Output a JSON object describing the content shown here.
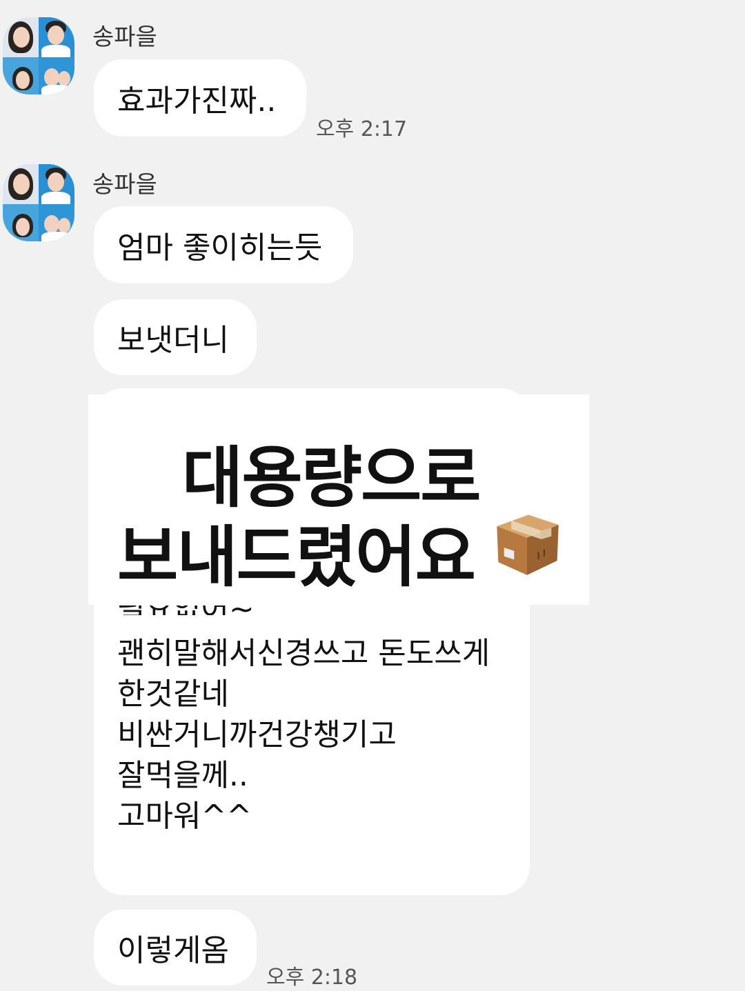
{
  "messages": {
    "sender_name_1": "송파을",
    "msg1": "효과가진짜..",
    "time1": "오후 2:17",
    "sender_name_2": "송파을",
    "msg2": "엄마 좋이히는듯",
    "msg3": "보냇더니",
    "screenshot": {
      "overlay_line1": "대용량으로",
      "overlay_line2": "보내드렸어요",
      "overlay_icon": "package-icon",
      "partial_line": "필요없어~",
      "lines": [
        "괜히말해서신경쓰고 돈도쓰게",
        "한것같네",
        "비싼거니까건강챙기고",
        "잘먹을께..",
        "고마워^^"
      ]
    },
    "msg4": "이렇게옴",
    "time2": "오후 2:18"
  },
  "colors": {
    "background": "#f1f1f1",
    "bubble": "#ffffff",
    "text": "#111111",
    "time": "#555555"
  }
}
